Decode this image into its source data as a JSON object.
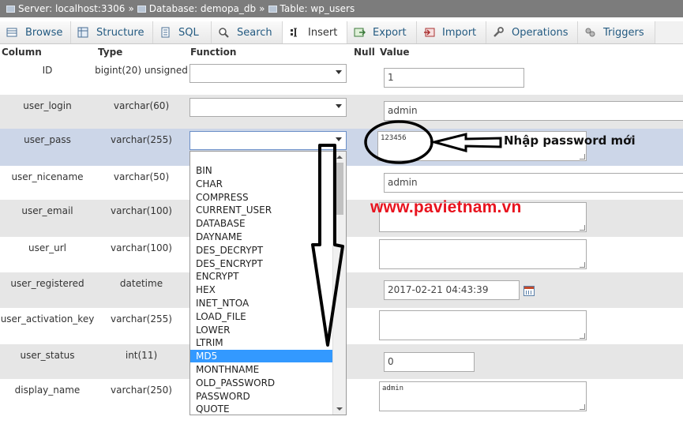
{
  "breadcrumb": {
    "server": "Server: localhost:3306",
    "database": "Database: demopa_db",
    "table": "Table: wp_users",
    "separator": "»"
  },
  "tabs": [
    {
      "label": "Browse",
      "icon": "browse-icon"
    },
    {
      "label": "Structure",
      "icon": "structure-icon"
    },
    {
      "label": "SQL",
      "icon": "sql-icon"
    },
    {
      "label": "Search",
      "icon": "search-icon"
    },
    {
      "label": "Insert",
      "icon": "insert-icon",
      "active": true
    },
    {
      "label": "Export",
      "icon": "export-icon"
    },
    {
      "label": "Import",
      "icon": "import-icon"
    },
    {
      "label": "Operations",
      "icon": "wrench-icon"
    },
    {
      "label": "Triggers",
      "icon": "triggers-icon"
    }
  ],
  "table_header": {
    "column": "Column",
    "type": "Type",
    "function": "Function",
    "null": "Null",
    "value": "Value"
  },
  "rows": [
    {
      "name": "ID",
      "type": "bigint(20) unsigned",
      "value": "1"
    },
    {
      "name": "user_login",
      "type": "varchar(60)",
      "value": "admin"
    },
    {
      "name": "user_pass",
      "type": "varchar(255)",
      "value": "123456"
    },
    {
      "name": "user_nicename",
      "type": "varchar(50)",
      "value": "admin"
    },
    {
      "name": "user_email",
      "type": "varchar(100)",
      "value": ""
    },
    {
      "name": "user_url",
      "type": "varchar(100)",
      "value": ""
    },
    {
      "name": "user_registered",
      "type": "datetime",
      "value": "2017-02-21 04:43:39"
    },
    {
      "name": "user_activation_key",
      "type": "varchar(255)",
      "value": ""
    },
    {
      "name": "user_status",
      "type": "int(11)",
      "value": "0"
    },
    {
      "name": "display_name",
      "type": "varchar(250)",
      "value": "admin"
    }
  ],
  "function_options": [
    "BIN",
    "CHAR",
    "COMPRESS",
    "CURRENT_USER",
    "DATABASE",
    "DAYNAME",
    "DES_DECRYPT",
    "DES_ENCRYPT",
    "ENCRYPT",
    "HEX",
    "INET_NTOA",
    "LOAD_FILE",
    "LOWER",
    "LTRIM",
    "MD5",
    "MONTHNAME",
    "OLD_PASSWORD",
    "PASSWORD",
    "QUOTE"
  ],
  "selected_function": "MD5",
  "annotation": "Nhập password mới",
  "watermark": "www.pavietnam.vn",
  "colors": {
    "highlight": "#3399ff",
    "watermark": "#e8141f",
    "row_highlight": "#ccd6e8"
  }
}
